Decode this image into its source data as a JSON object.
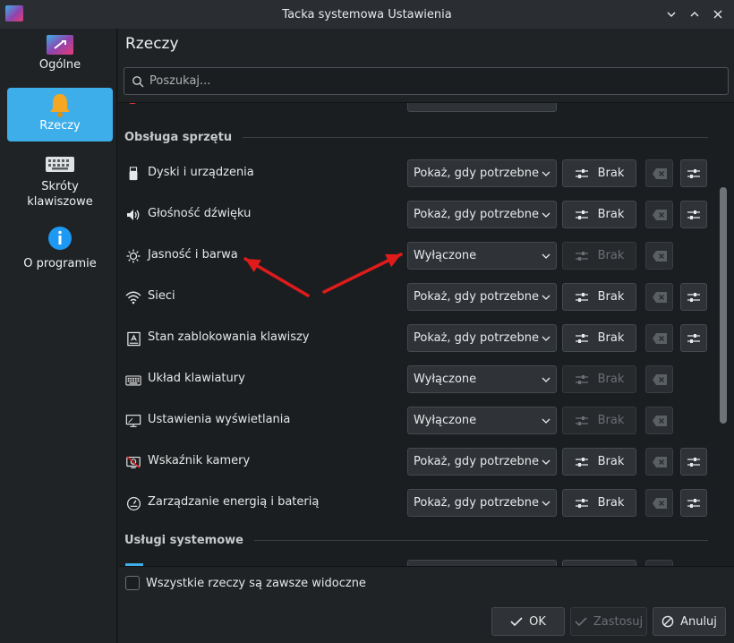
{
  "window": {
    "title": "Tacka systemowa Ustawienia"
  },
  "sidebar": {
    "items": [
      {
        "label": "Ogólne",
        "icon": "general-settings-icon"
      },
      {
        "label": "Rzeczy",
        "icon": "bell-icon",
        "active": true
      },
      {
        "label": "Skróty klawiszowe",
        "icon": "keyboard-icon"
      },
      {
        "label": "O programie",
        "icon": "info-icon"
      }
    ]
  },
  "main": {
    "title": "Rzeczy",
    "search_placeholder": "Poszukaj...",
    "sections": [
      {
        "title": "Obsługa sprzętu"
      },
      {
        "title": "Usługi systemowe"
      }
    ],
    "rows": [
      {
        "name": "Dyski i urządzenia",
        "icon": "usb-drive-icon",
        "visibility": "Pokaż, gdy potrzebne",
        "shortcut": "Brak",
        "enabled": true
      },
      {
        "name": "Głośność dźwięku",
        "icon": "speaker-icon",
        "visibility": "Pokaż, gdy potrzebne",
        "shortcut": "Brak",
        "enabled": true
      },
      {
        "name": "Jasność i barwa",
        "icon": "brightness-icon",
        "visibility": "Wyłączone",
        "shortcut": "Brak",
        "enabled": false
      },
      {
        "name": "Sieci",
        "icon": "wifi-icon",
        "visibility": "Pokaż, gdy potrzebne",
        "shortcut": "Brak",
        "enabled": true
      },
      {
        "name": "Stan zablokowania klawiszy",
        "icon": "caps-lock-icon",
        "visibility": "Pokaż, gdy potrzebne",
        "shortcut": "Brak",
        "enabled": true
      },
      {
        "name": "Układ klawiatury",
        "icon": "keyboard-layout-icon",
        "visibility": "Wyłączone",
        "shortcut": "Brak",
        "enabled": false
      },
      {
        "name": "Ustawienia wyświetlania",
        "icon": "display-icon",
        "visibility": "Wyłączone",
        "shortcut": "Brak",
        "enabled": false
      },
      {
        "name": "Wskaźnik kamery",
        "icon": "camera-off-icon",
        "visibility": "Pokaż, gdy potrzebne",
        "shortcut": "Brak",
        "enabled": true
      },
      {
        "name": "Zarządzanie energią i baterią",
        "icon": "power-gauge-icon",
        "visibility": "Pokaż, gdy potrzebne",
        "shortcut": "Brak",
        "enabled": true
      }
    ],
    "always_visible_label": "Wszystkie rzeczy są zawsze widoczne"
  },
  "footer": {
    "ok": "OK",
    "apply": "Zastosuj",
    "cancel": "Anuluj"
  },
  "colors": {
    "accent": "#3daee9",
    "annotation_arrow": "#e01b1b"
  }
}
